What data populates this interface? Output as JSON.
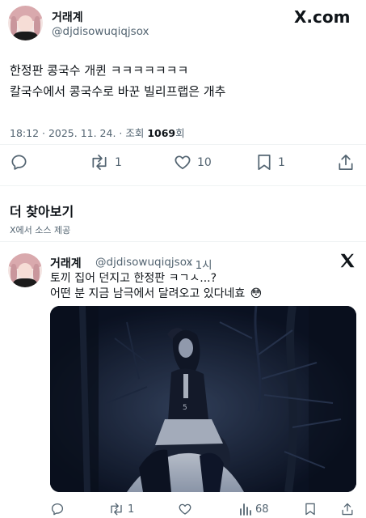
{
  "main_tweet": {
    "display_name": "거래계",
    "handle": "@djdisowuqiqjsox",
    "text_lines": [
      "한정판 콩국수 개퀸 ㅋㅋㅋㅋㅋㅋㅋ",
      "칼국수에서 콩국수로 바꾼 빌리프랩은 개추"
    ],
    "time": "18:12 · 2025. 11. 24. · 조회 ",
    "views": "1069",
    "views_suffix": "회",
    "replies_count": "",
    "retweets_count": "1",
    "likes_count": "10",
    "bookmarks_count": "1"
  },
  "brand": {
    "logo_text": "X.com"
  },
  "discover": {
    "title": "더 찾아보기",
    "subtitle": "X에서 소스 제공"
  },
  "suggested_tweet": {
    "display_name": "거래계",
    "handle": "@djdisowuqiqjsox",
    "age": "· 1시",
    "text_lines": [
      "토끼 집어 던지고 한정판 ㅋㄱㅅ...?",
      "어떤 분 지금 남극에서 달려오고 있다네효"
    ],
    "emoji": "😳",
    "retweets_count": "1",
    "views_count": "68"
  },
  "colors": {
    "text": "#0f1419",
    "secondary": "#536471",
    "divider": "#eff3f4",
    "media_bg": "#0e1524"
  },
  "icons": [
    "reply-icon",
    "retweet-icon",
    "like-icon",
    "bookmark-icon",
    "share-icon",
    "x-logo-icon",
    "views-icon"
  ]
}
